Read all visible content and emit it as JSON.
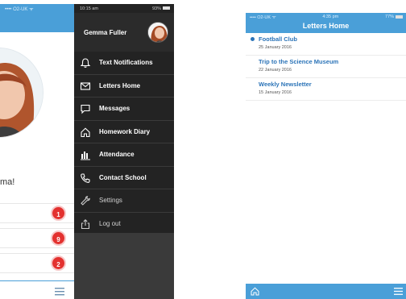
{
  "left_phone": {
    "under_status": "•••• O2-UK ᯤ",
    "greeting_fragment": "ma!",
    "badges": [
      "1",
      "9",
      "2"
    ],
    "drawer": {
      "status_time": "10:15 am",
      "status_battery": "93%",
      "user_name": "Gemma Fuller",
      "menu_items": [
        {
          "label": "Text Notifications",
          "icon": "bell-icon"
        },
        {
          "label": "Letters Home",
          "icon": "envelope-icon"
        },
        {
          "label": "Messages",
          "icon": "message-icon"
        },
        {
          "label": "Homework Diary",
          "icon": "home-icon"
        },
        {
          "label": "Attendance",
          "icon": "bar-chart-icon"
        },
        {
          "label": "Contact School",
          "icon": "phone-icon"
        },
        {
          "label": "Settings",
          "icon": "wrench-icon"
        },
        {
          "label": "Log out",
          "icon": "logout-icon"
        }
      ]
    }
  },
  "right_phone": {
    "status_carrier": "•••• O2-UK ᯤ",
    "status_time": "4:35 pm",
    "status_battery": "77%",
    "title": "Letters Home",
    "letters": [
      {
        "title": "Football Club",
        "date": "25 January 2016",
        "unread": true
      },
      {
        "title": "Trip to the Science Museum",
        "date": "22 January 2016",
        "unread": false
      },
      {
        "title": "Weekly Newsletter",
        "date": "15 January 2016",
        "unread": false
      }
    ]
  },
  "colors": {
    "brand_blue": "#4a9fd8",
    "drawer_dark": "#232323",
    "badge_red": "#e3312f",
    "link_blue": "#2c74b8"
  }
}
